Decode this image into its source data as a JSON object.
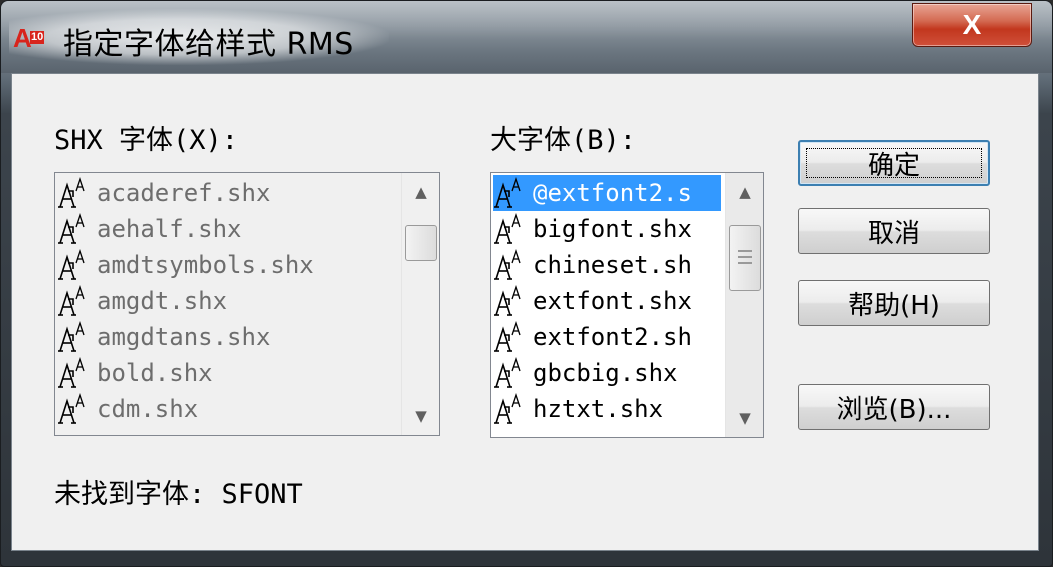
{
  "window": {
    "title": "指定字体给样式 RMS",
    "app_icon_letter": "A",
    "app_icon_badge": "10",
    "close_glyph": "X"
  },
  "shx": {
    "label": "SHX 字体(X):",
    "items": [
      "acaderef.shx",
      "aehalf.shx",
      "amdtsymbols.shx",
      "amgdt.shx",
      "amgdtans.shx",
      "bold.shx",
      "cdm.shx"
    ],
    "icon": "font-icon"
  },
  "bigfont": {
    "label": "大字体(B):",
    "items": [
      "@extfont2.s",
      "bigfont.shx",
      "chineset.sh",
      "extfont.shx",
      "extfont2.sh",
      "gbcbig.shx",
      "hztxt.shx"
    ],
    "selected_index": 0,
    "icon": "font-icon"
  },
  "buttons": {
    "ok": "确定",
    "cancel": "取消",
    "help": "帮助(H)",
    "browse": "浏览(B)..."
  },
  "status": {
    "text": "未找到字体: SFONT"
  },
  "colors": {
    "selection": "#3399ff",
    "close_button": "#c2371e",
    "app_icon": "#d8241c"
  }
}
